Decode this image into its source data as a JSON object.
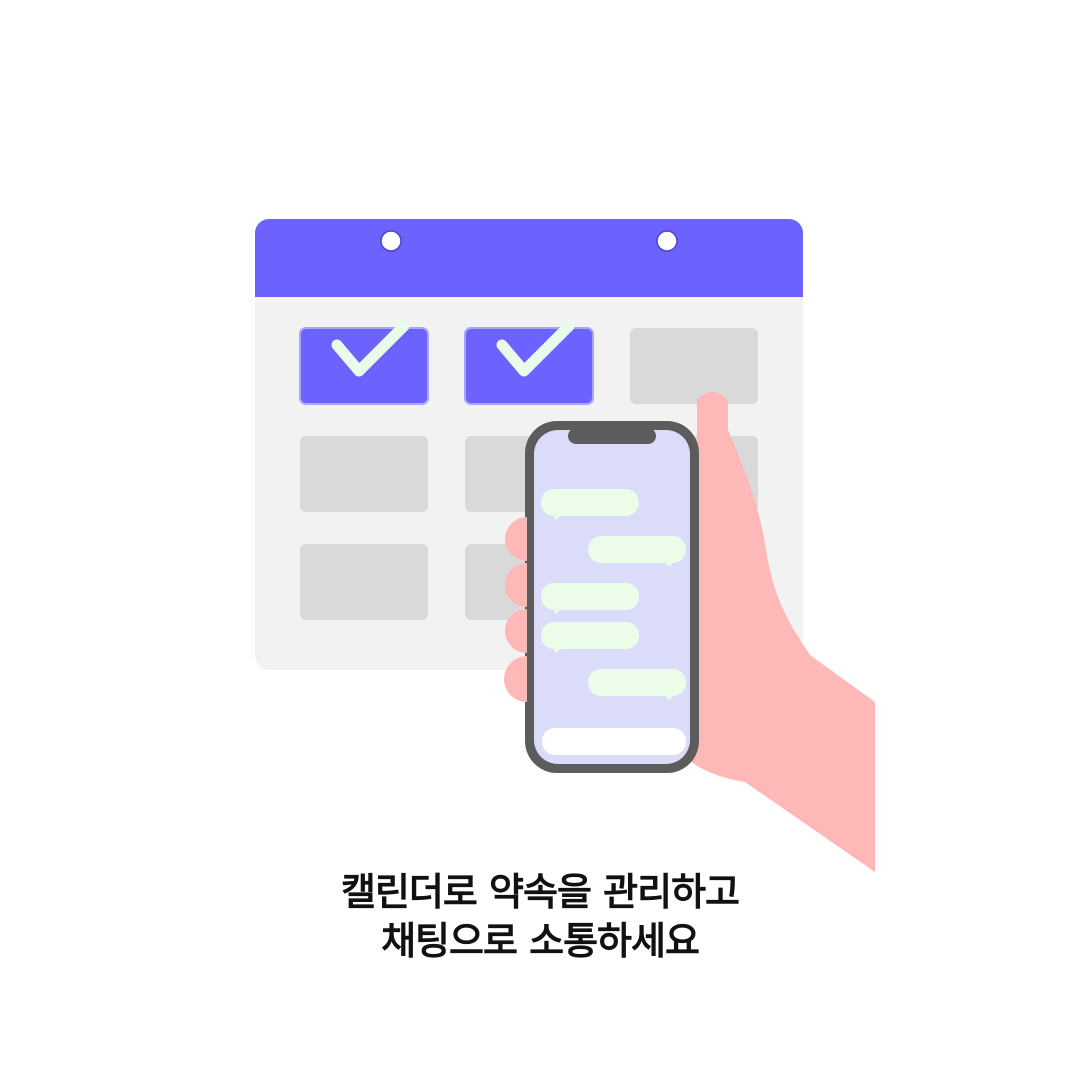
{
  "caption": {
    "line1": "캘린더로 약속을 관리하고",
    "line2": "채팅으로 소통하세요"
  },
  "calendar": {
    "cells": [
      {
        "checked": true
      },
      {
        "checked": true
      },
      {
        "checked": false
      },
      {
        "checked": false
      },
      {
        "checked": false
      },
      {
        "checked": false
      },
      {
        "checked": false
      },
      {
        "checked": false
      },
      {
        "checked": false
      }
    ]
  },
  "chat": {
    "messages": [
      {
        "side": "left"
      },
      {
        "side": "right"
      },
      {
        "side": "left"
      },
      {
        "side": "left"
      },
      {
        "side": "right"
      }
    ]
  },
  "colors": {
    "accent": "#6c63ff",
    "calendar_body": "#f2f2f2",
    "cell_empty": "#d9d9d9",
    "check": "#e9fbe9",
    "skin": "#ffb8b8",
    "phone_frame": "#5c5c5c",
    "phone_screen": "#dbdcf9",
    "bubble": "#ebfce9",
    "input_bar": "#ffffff"
  }
}
